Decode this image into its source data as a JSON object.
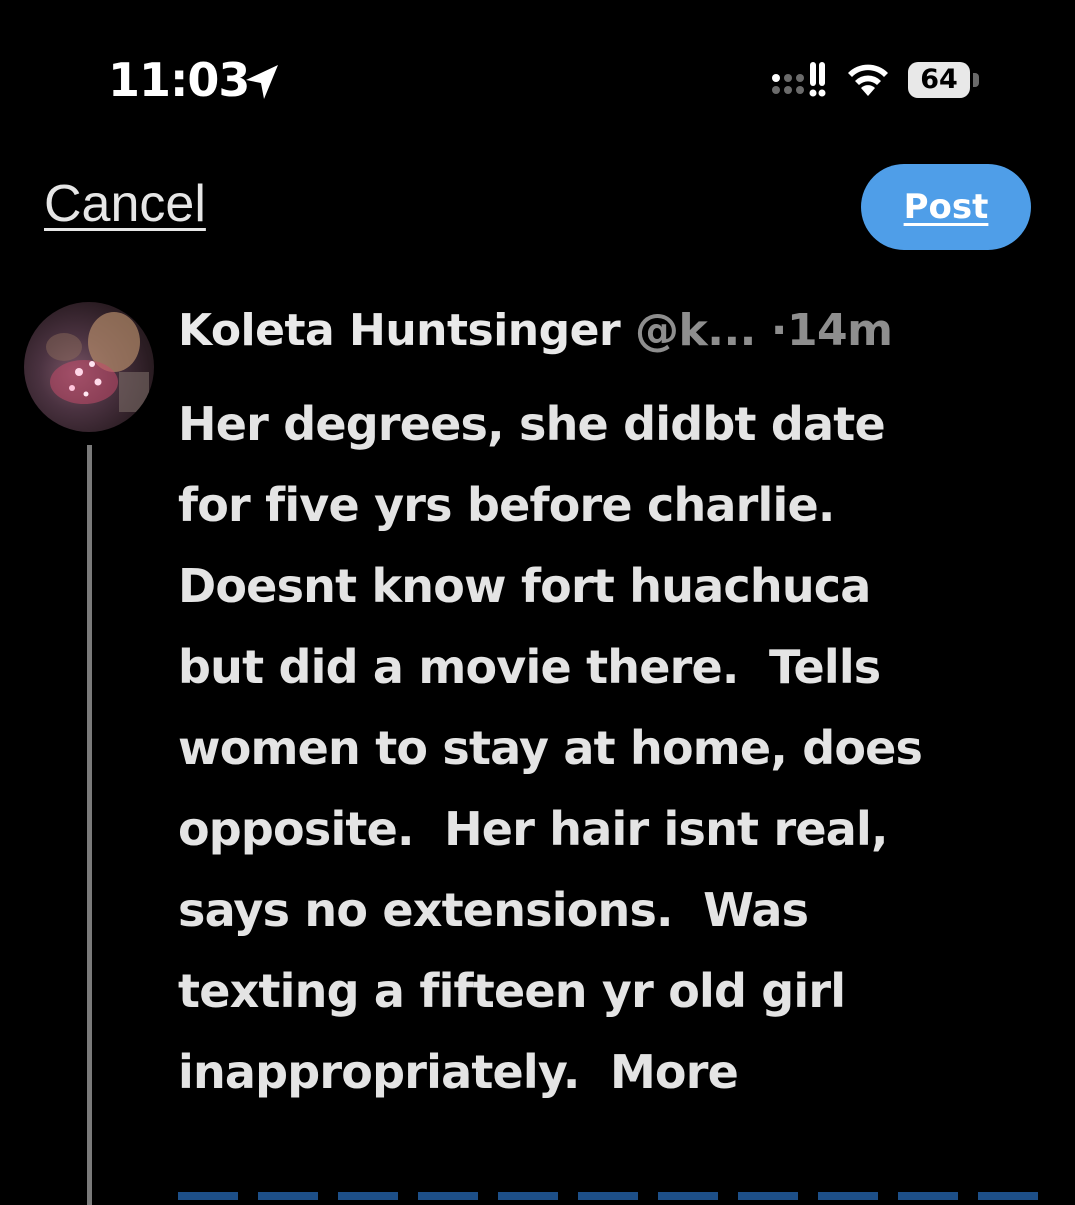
{
  "status_bar": {
    "time": "11:03",
    "location_icon": "location-arrow-icon",
    "signal_icon": "cellular-signal-icon",
    "wifi_icon": "wifi-icon",
    "battery_level": "64"
  },
  "header": {
    "cancel_label": "Cancel",
    "post_label": "Post"
  },
  "colors": {
    "background": "#000000",
    "post_button": "#4f9ee8",
    "text_primary": "#e4e4e4",
    "text_secondary": "#8e8e8e"
  },
  "tweet": {
    "author_name": "Koleta Huntsinger",
    "author_handle": "@k...",
    "separator": "·",
    "timestamp": "14m",
    "body_lines": [
      "Her degrees, she didbt date",
      "for five yrs before charlie.",
      "Doesnt know fort huachuca",
      "but did a movie there.  Tells",
      "women to stay at home, does",
      "opposite.  Her hair isnt real,",
      "says no extensions.  Was",
      "texting a fifteen yr old girl",
      "inappropriately.  More"
    ]
  }
}
